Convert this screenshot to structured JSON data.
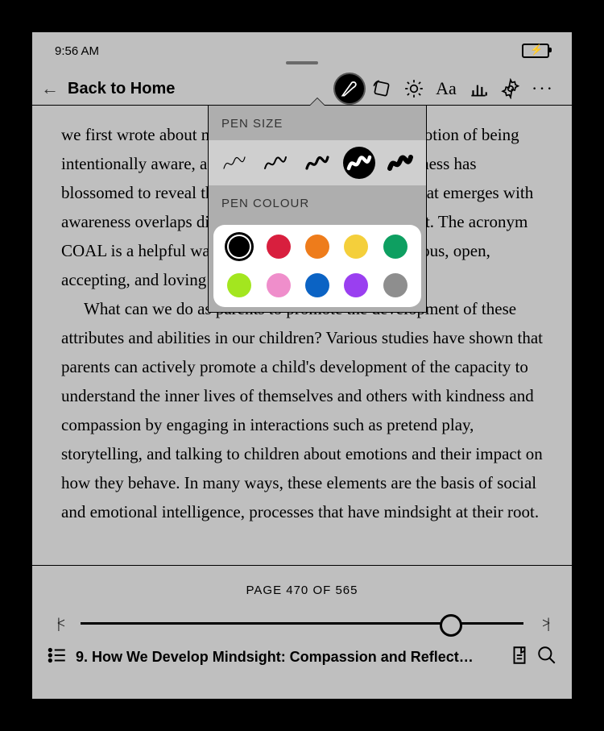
{
  "status": {
    "time": "9:56 AM"
  },
  "header": {
    "back_label": "Back to Home"
  },
  "body": {
    "para1": "we first wrote about mindful awareness, the general notion of being intentionally aware, as well as the science of mindfulness has blossomed to reveal that the presence and openness that emerges with awareness overlaps directly with the idea of mindsight. The acronym COAL is a helpful way to remember this: we are curious, open, accepting, and loving toward ourselves.",
    "para2": "What can we do as parents to promote the development of these attributes and abilities in our children? Various studies have shown that parents can actively promote a child's development of the capacity to understand the inner lives of themselves and others with kindness and compassion by engaging in interactions such as pretend play, storytelling, and talking to children about emotions and their impact on how they behave. In many ways, these elements are the basis of social and emotional intelligence, processes that have mindsight at their root."
  },
  "footer": {
    "page_indicator": "PAGE 470 OF 565",
    "progress_pct": 83,
    "chapter_title": "9. How We Develop Mindsight: Compassion and Reflect…"
  },
  "popover": {
    "pensize_label": "PEN SIZE",
    "pencolour_label": "PEN COLOUR",
    "sizes": [
      1.2,
      2.0,
      3.2,
      4.5,
      6.0
    ],
    "selected_size_index": 3,
    "colours_row1": [
      "#000000",
      "#d81f3e",
      "#ee7c1b",
      "#f4cf3b",
      "#0e9f61"
    ],
    "colours_row2": [
      "#a3e61f",
      "#ef8ecb",
      "#0b63c4",
      "#9a3ff0",
      "#8e8e8e"
    ],
    "selected_colour": "#000000"
  }
}
